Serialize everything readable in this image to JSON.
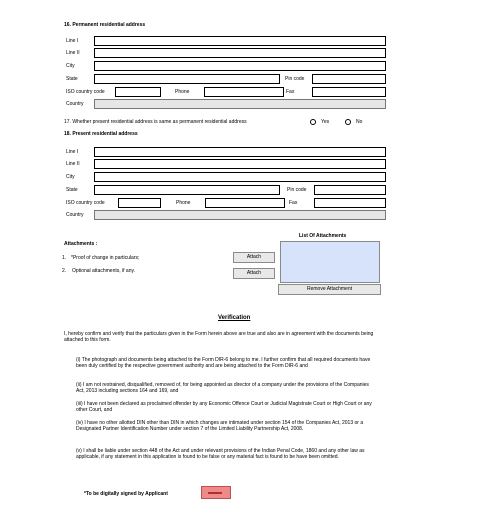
{
  "permanent_address": {
    "heading": "16. Permanent residential address",
    "line1": "Line I",
    "line2": "Line II",
    "city": "City",
    "state": "State",
    "pin_code": "Pin code",
    "iso_country_code": "ISO country code",
    "phone": "Phone",
    "fax": "Fax",
    "country": "Country"
  },
  "question17": {
    "text": "17. Whether present residential address is same as permanent residential address",
    "yes": "Yes",
    "no": "No"
  },
  "present_address": {
    "heading": "18. Present residential address",
    "line1": "Line I",
    "line2": "Line II",
    "city": "City",
    "state": "State",
    "pin_code": "Pin code",
    "iso_country_code": "ISO country code",
    "phone": "Phone",
    "fax": "Fax",
    "country": "Country"
  },
  "attachments": {
    "heading": "Attachments :",
    "list_title": "List Of Attachments",
    "item1_num": "1.",
    "item1_text": "*Proof of change in particulars;",
    "item2_num": "2.",
    "item2_text": "Optional attachments, if any.",
    "attach_label": "Attach",
    "remove_label": "Remove Attachment"
  },
  "verification": {
    "title": "Verification",
    "intro": "I, hereby confirm and verify that the particulars given in the Form herein above are true and also are in agreement with the documents being attached to this form.",
    "points": [
      "(i) The photograph and documents being attached to the Form DIR-6 belong to me. I further confirm that all required documents have been duly certified by the respective government authority and are being attached to the Form DIR-6 and",
      "(ii) I am not restrained, disqualified, removed of, for being appointed as director of a company under the provisions of the Companies Act, 2013 including sections 164 and 169, and",
      "(iii) I have not been declared as proclaimed offender by any Economic Offence Court or Judicial Magistrate Court or High Court or any other Court, and",
      "(iv) I have no other allotted DIN other than DIN in which changes are intimated under section 154 of the Companies Act, 2013 or a Designated Partner Identification Number under section 7 of the Limited Liability Partnership Act, 2008.",
      "(v) I shall be liable under section 448 of the Act and under relevant provisions of the Indian Penal Code, 1860 and any other law as applicable, if any statement in this application is found to be false or any material fact is found to be have been omitted."
    ],
    "sign_label": "*To be digitally signed by Applicant"
  }
}
